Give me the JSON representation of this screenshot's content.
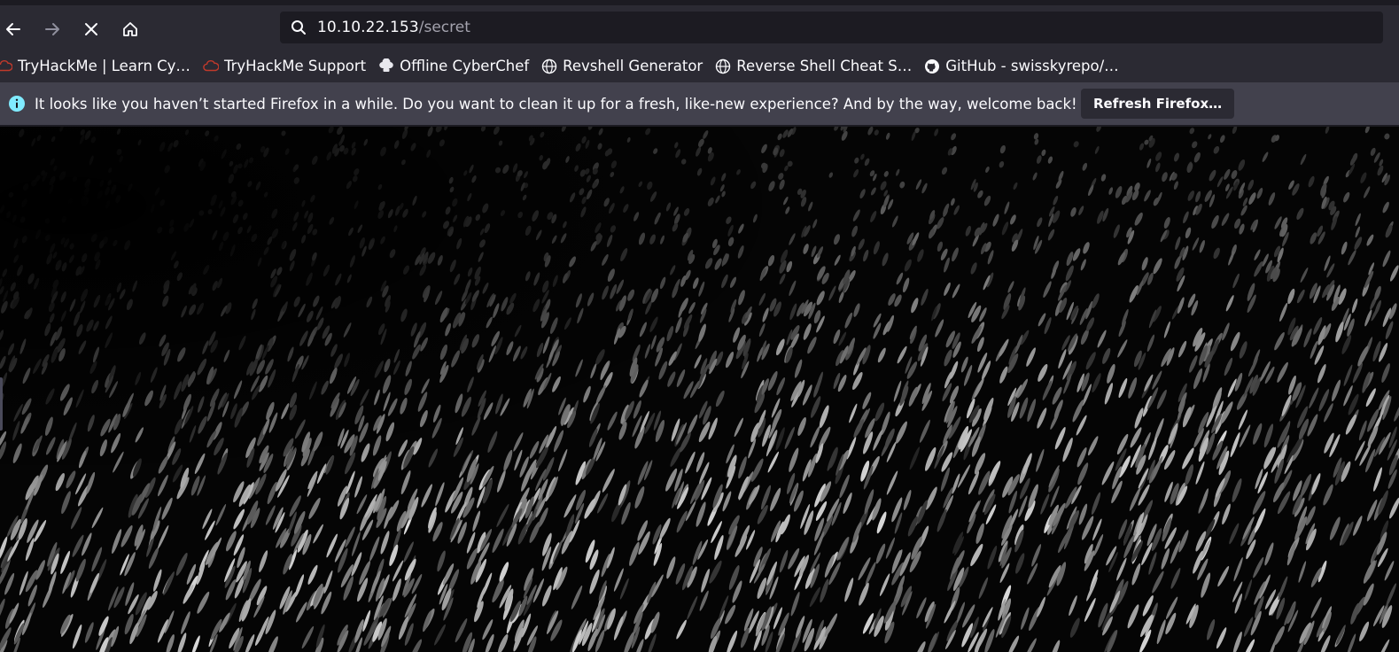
{
  "toolbar": {
    "url_host": "10.10.22.153",
    "url_path": "/secret",
    "icons": [
      "back-arrow-icon",
      "forward-arrow-icon",
      "stop-loading-icon",
      "home-icon",
      "search-icon"
    ]
  },
  "bookmarks": [
    {
      "label": "TryHackMe | Learn Cy…",
      "icon": "tryhackme-cloud-icon"
    },
    {
      "label": "TryHackMe Support",
      "icon": "tryhackme-cloud-icon"
    },
    {
      "label": "Offline CyberChef",
      "icon": "chef-hat-icon"
    },
    {
      "label": "Revshell Generator",
      "icon": "globe-icon"
    },
    {
      "label": "Reverse Shell Cheat S…",
      "icon": "globe-icon"
    },
    {
      "label": "GitHub - swisskyrepo/…",
      "icon": "github-icon"
    }
  ],
  "notification": {
    "message": "It looks like you haven’t started Firefox in a while. Do you want to clean it up for a fresh, like-new experience? And by the way, welcome back!",
    "button_label": "Refresh Firefox…",
    "icon": "info-icon"
  },
  "colors": {
    "toolbar_bg": "#2b2a33",
    "urlbar_bg": "#1c1b22",
    "notice_bg": "#42414d",
    "text": "#fbfbfe",
    "dim_text": "#a3a2ad",
    "page_bg": "#000000",
    "brand_red": "#c0392b"
  }
}
